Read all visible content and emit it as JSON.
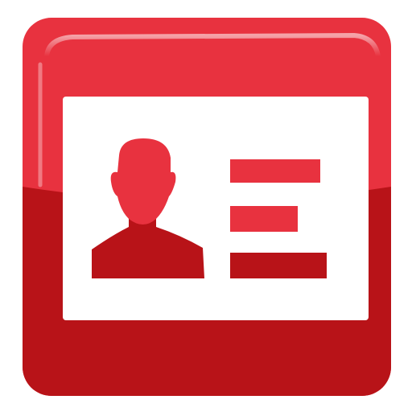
{
  "icon": {
    "name": "id-card-icon",
    "colors": {
      "accent_light": "#e8323f",
      "accent_dark": "#b81318",
      "card": "#ffffff",
      "highlight": "#ffffff"
    }
  }
}
